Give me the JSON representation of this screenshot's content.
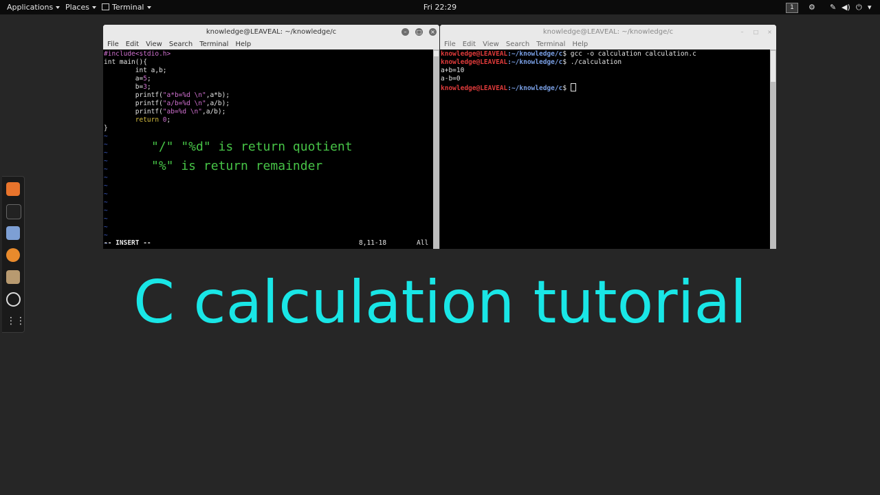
{
  "topbar": {
    "applications": "Applications",
    "places": "Places",
    "terminal": "Terminal",
    "clock": "Fri 22:29",
    "workspace": "1"
  },
  "dock": {
    "icons": [
      "firefox-icon",
      "terminal-icon",
      "files-icon",
      "blender-icon",
      "archive-icon",
      "obs-icon",
      "app-grid-icon"
    ]
  },
  "left_window": {
    "title": "knowledge@LEAVEAL: ~/knowledge/c",
    "menu": [
      "File",
      "Edit",
      "View",
      "Search",
      "Terminal",
      "Help"
    ],
    "code": [
      {
        "a": "#include",
        "b": "<stdio.h>"
      },
      {
        "a": "int main(){"
      },
      {
        "a": "        int a,b;"
      },
      {
        "a": "        a=",
        "b": "5",
        "c": ";"
      },
      {
        "a": "        b=",
        "b": "3",
        "c": ";"
      },
      {
        "a": "        printf(",
        "b": "\"a*b=%d \\n\"",
        "c": ",a*b);"
      },
      {
        "a": "        printf(",
        "b": "\"a/b=%d \\n\"",
        "c": ",a/b);"
      },
      {
        "a": "        printf(",
        "b": "\"ab=%d \\n\"",
        "c": ",a/b);"
      },
      {
        "a": "        return ",
        "b": "0",
        "c": ";"
      },
      {
        "a": "}"
      }
    ],
    "tilde": "~",
    "note_line1": "\"/\" \"%d\" is return quotient",
    "note_line2": "\"%\" is return remainder",
    "status_mode": "-- INSERT --",
    "status_pos": "8,11-18",
    "status_all": "All"
  },
  "right_window": {
    "title": "knowledge@LEAVEAL: ~/knowledge/c",
    "menu": [
      "File",
      "Edit",
      "View",
      "Search",
      "Terminal",
      "Help"
    ],
    "prompt_user": "knowledge@LEAVEAL",
    "prompt_path": ":~/knowledge/c",
    "prompt_sign": "$ ",
    "cmd1": "gcc -o calculation calculation.c",
    "cmd2": "./calculation",
    "out1": "a+b=10",
    "out2": "a-b=0"
  },
  "caption": "C calculation tutorial"
}
